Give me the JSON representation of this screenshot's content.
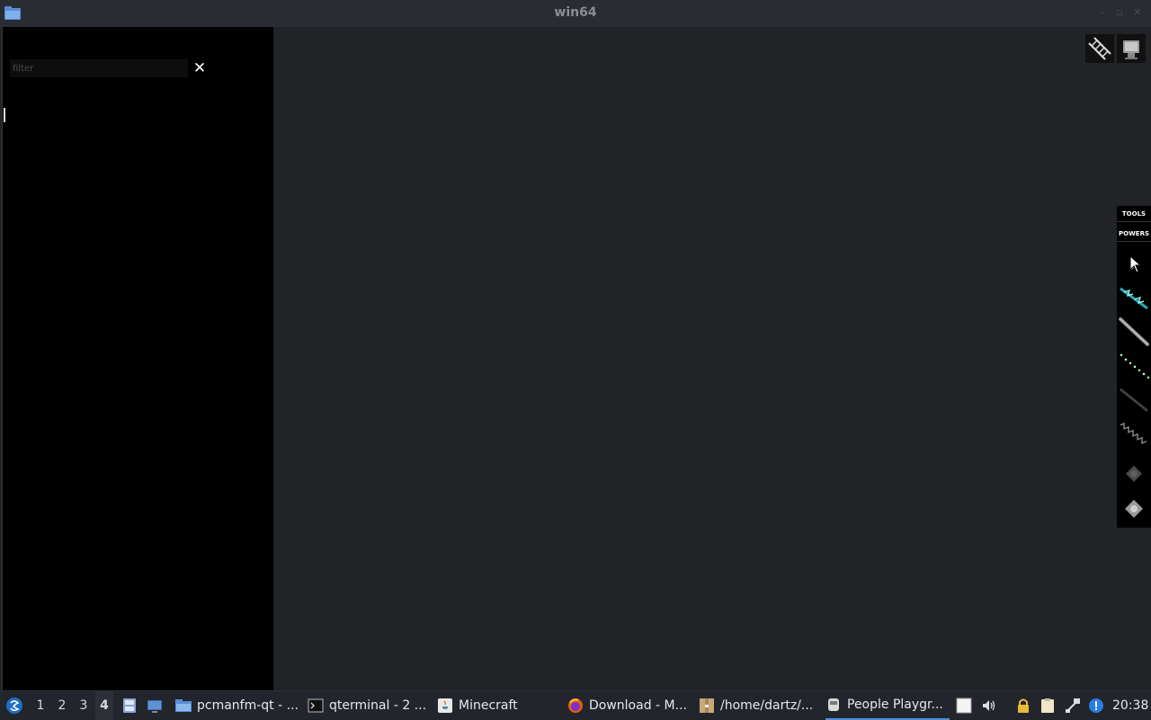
{
  "window": {
    "title": "win64",
    "controls": [
      "–",
      "▫",
      "✕"
    ]
  },
  "sidepanel": {
    "filter_placeholder": "filter",
    "filter_value": "",
    "clear_symbol": "✕"
  },
  "top_tools": [
    {
      "icon": "ladder-icon"
    },
    {
      "icon": "monitor-icon"
    }
  ],
  "toolbar": {
    "tabs": [
      {
        "label": "TOOLS"
      },
      {
        "label": "POWERS"
      }
    ],
    "items": [
      {
        "icon": "drag-cursor-icon"
      },
      {
        "icon": "electric-wire-icon"
      },
      {
        "icon": "steel-rod-icon"
      },
      {
        "icon": "green-chain-icon"
      },
      {
        "icon": "cable-icon"
      },
      {
        "icon": "spring-icon"
      },
      {
        "icon": "dark-gear-icon"
      },
      {
        "icon": "light-gear-icon"
      }
    ]
  },
  "taskbar": {
    "desktops": [
      "1",
      "2",
      "3",
      "4"
    ],
    "active_desktop": "4",
    "tasks": [
      {
        "label": "pcmanfm-qt - ...",
        "icon": "folder-icon"
      },
      {
        "label": "qterminal - 2 ...",
        "icon": "terminal-icon"
      },
      {
        "label": "Minecraft",
        "icon": "java-icon"
      },
      {
        "label": "Download - M...",
        "icon": "firefox-icon"
      },
      {
        "label": "/home/dartz/...",
        "icon": "archive-icon"
      },
      {
        "label": "People Playgr...",
        "icon": "game-icon",
        "active": true
      }
    ],
    "clock": "20:38"
  },
  "colors": {
    "background": "#222327",
    "panel": "#000000",
    "taskbar": "#23252c",
    "accent": "#4a8fd8"
  }
}
